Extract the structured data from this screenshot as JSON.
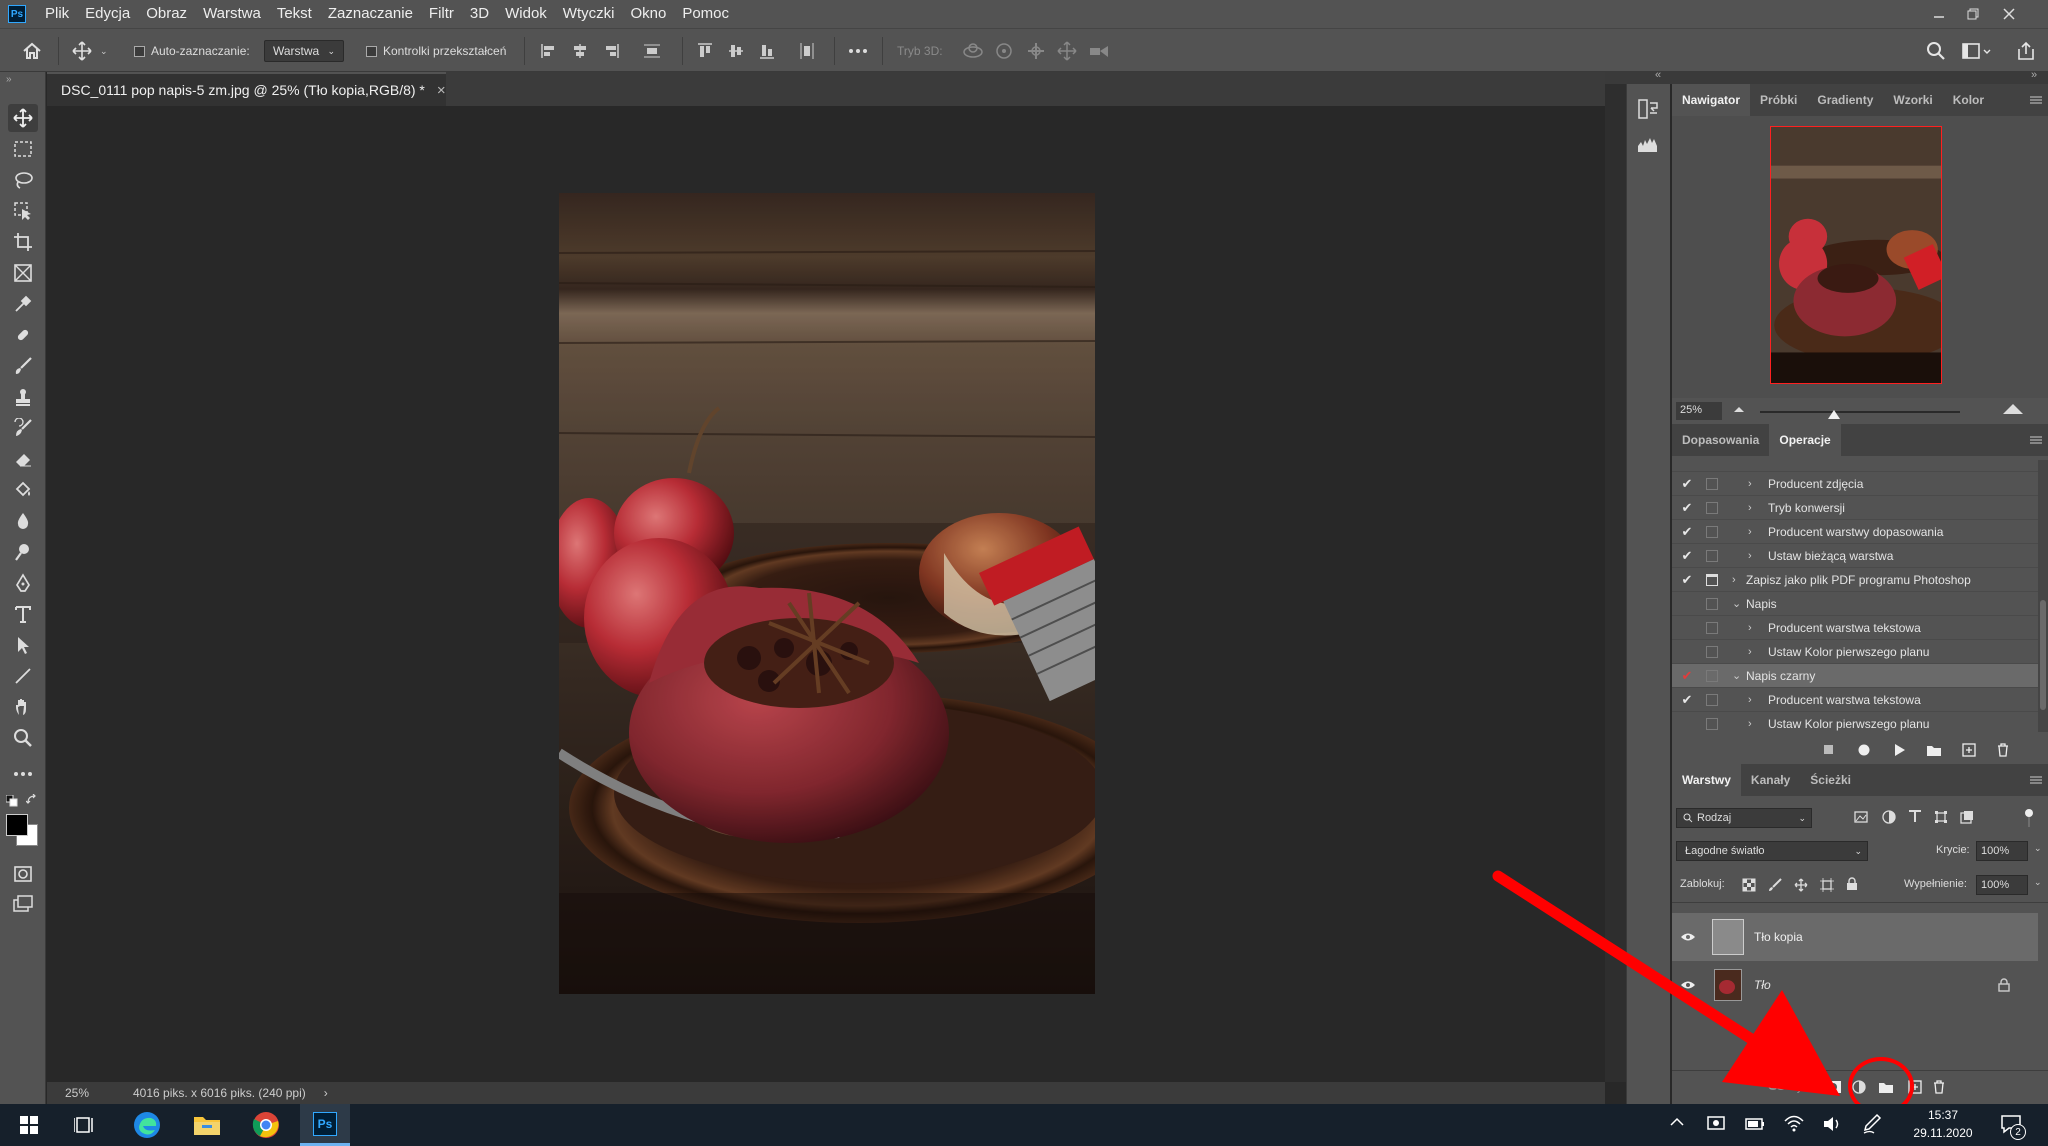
{
  "menu": {
    "logo": "Ps",
    "items": [
      "Plik",
      "Edycja",
      "Obraz",
      "Warstwa",
      "Tekst",
      "Zaznaczanie",
      "Filtr",
      "3D",
      "Widok",
      "Wtyczki",
      "Okno",
      "Pomoc"
    ]
  },
  "options_bar": {
    "auto_select_label": "Auto-zaznaczanie:",
    "auto_select_value": "Warstwa",
    "transform_controls_label": "Kontrolki przekształceń",
    "mode3d_label": "Tryb 3D:"
  },
  "document": {
    "tab_title": "DSC_0111 pop napis-5 zm.jpg @ 25% (Tło kopia,RGB/8) *",
    "close_glyph": "×"
  },
  "status": {
    "zoom": "25%",
    "info": "4016 piks. x 6016 piks. (240 ppi)",
    "arrow": "›"
  },
  "navigator": {
    "tabs": [
      "Nawigator",
      "Próbki",
      "Gradienty",
      "Wzorki",
      "Kolor"
    ],
    "active_tab": "Nawigator",
    "zoom": "25%",
    "zoom_slider_fraction": 0.37
  },
  "operations": {
    "tabs": [
      "Dopasowania",
      "Operacje"
    ],
    "active_tab": "Operacje",
    "rows": [
      {
        "check": "✔",
        "box": "",
        "indent": 2,
        "expander": "›",
        "label": "Producent zdjęcia",
        "red": false,
        "highlight": false
      },
      {
        "check": "✔",
        "box": "",
        "indent": 2,
        "expander": "›",
        "label": "Tryb konwersji",
        "red": false,
        "highlight": false
      },
      {
        "check": "✔",
        "box": "",
        "indent": 2,
        "expander": "›",
        "label": "Producent warstwy dopasowania",
        "red": false,
        "highlight": false
      },
      {
        "check": "✔",
        "box": "",
        "indent": 2,
        "expander": "›",
        "label": "Ustaw bieżącą warstwa",
        "red": false,
        "highlight": false
      },
      {
        "check": "✔",
        "box": "dialog",
        "indent": 1,
        "expander": "›",
        "label": "Zapisz jako plik PDF programu Photoshop",
        "red": false,
        "highlight": false
      },
      {
        "check": "",
        "box": "",
        "indent": 1,
        "expander": "⌄",
        "label": "Napis",
        "red": false,
        "highlight": false
      },
      {
        "check": "",
        "box": "",
        "indent": 2,
        "expander": "›",
        "label": "Producent warstwa tekstowa",
        "red": false,
        "highlight": false
      },
      {
        "check": "",
        "box": "",
        "indent": 2,
        "expander": "›",
        "label": "Ustaw Kolor pierwszego planu",
        "red": false,
        "highlight": false
      },
      {
        "check": "✔",
        "box": "",
        "indent": 1,
        "expander": "⌄",
        "label": "Napis czarny",
        "red": true,
        "highlight": true
      },
      {
        "check": "✔",
        "box": "",
        "indent": 2,
        "expander": "›",
        "label": "Producent warstwa tekstowa",
        "red": false,
        "highlight": false
      },
      {
        "check": "",
        "box": "",
        "indent": 2,
        "expander": "›",
        "label": "Ustaw Kolor pierwszego planu",
        "red": false,
        "highlight": false
      }
    ]
  },
  "layers": {
    "tabs": [
      "Warstwy",
      "Kanały",
      "Ścieżki"
    ],
    "active_tab": "Warstwy",
    "filter_label": "Rodzaj",
    "blend_mode": "Łagodne światło",
    "opacity_label": "Krycie:",
    "opacity_value": "100%",
    "lock_label": "Zablokuj:",
    "fill_label": "Wypełnienie:",
    "fill_value": "100%",
    "items": [
      {
        "name": "Tło kopia",
        "selected": true,
        "italic": false,
        "locked": false
      },
      {
        "name": "Tło",
        "selected": false,
        "italic": true,
        "locked": true
      }
    ]
  },
  "taskbar": {
    "time": "15:37",
    "date": "29.11.2020",
    "notification_count": "2"
  },
  "colors": {
    "annotation_red": "#ff0000",
    "panel_bg": "#535353",
    "canvas_bg": "#282828"
  }
}
